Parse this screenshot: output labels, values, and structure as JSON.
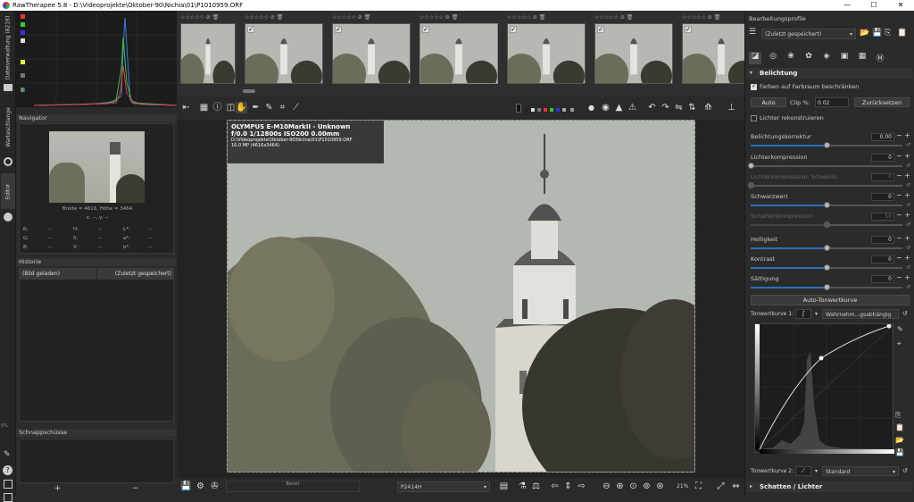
{
  "window": {
    "title": "RawTherapee 5.8 - D:\\Videoprojekte\\Oktober-90\\Nichia\\01\\P1010959.ORF",
    "minimize": "—",
    "maximize": "☐",
    "close": "✕"
  },
  "left_tabs": {
    "file_browser": "Dateiverwaltung (8216)",
    "queue": "Warteschlange",
    "editor": "Editor",
    "zoom_pct": "0%"
  },
  "navigator": {
    "title": "Navigator",
    "dims": "Breite = 4616, Höhe = 3464",
    "coords": "x: --, y: --",
    "rows": [
      [
        "R:",
        "--",
        "H:",
        "--",
        "L*:",
        "--"
      ],
      [
        "G:",
        "--",
        "S:",
        "--",
        "a*:",
        "--"
      ],
      [
        "B:",
        "--",
        "V:",
        "--",
        "b*:",
        "--"
      ]
    ]
  },
  "history": {
    "title": "Historie",
    "col1": "(Bild geladen)",
    "col2": "(Zuletzt gespeichert)"
  },
  "snapshots": {
    "title": "Schnappschüsse",
    "add": "+",
    "remove": "−"
  },
  "exif": {
    "camera": "OLYMPUS E-M10MarkII - Unknown",
    "settings": "f/0.0  1/12800s  ISO200  0.00mm",
    "path": "D:\\Videoprojekte\\Oktober-90\\Nichia\\01\\P1010959.ORF",
    "mp": "16.0 MP (4616x3464)"
  },
  "bottom": {
    "ready": "Bereit",
    "profile": "P2414H",
    "zoom": "21%"
  },
  "right": {
    "title": "Bearbeitungsprofile",
    "profile_value": "(Zuletzt gespeichert)",
    "section_exposure": "Belichtung",
    "clip_check": "Farben auf Farbraum beschränken",
    "auto": "Auto",
    "clip_label": "Clip %:",
    "clip_value": "0.02",
    "reset": "Zurücksetzen",
    "highlight_recon": "Lichter rekonstruieren",
    "sliders": [
      {
        "label": "Belichtungskorrektur",
        "value": "0.00",
        "pos": 0.5
      },
      {
        "label": "Lichterkompression",
        "value": "0",
        "pos": 0.0
      },
      {
        "label": "Lichterkompression: Schwelle",
        "value": "0",
        "pos": 0.0,
        "disabled": true
      },
      {
        "label": "Schwarzwert",
        "value": "0",
        "pos": 0.5
      },
      {
        "label": "Schattenkompression",
        "value": "50",
        "pos": 0.5,
        "disabled": true
      },
      {
        "label": "Helligkeit",
        "value": "0",
        "pos": 0.5
      },
      {
        "label": "Kontrast",
        "value": "0",
        "pos": 0.5
      },
      {
        "label": "Sättigung",
        "value": "0",
        "pos": 0.5
      }
    ],
    "auto_tone": "Auto-Tonwertkurve",
    "curve1_label": "Tonwertkurve 1:",
    "curve1_mode": "Wahrnehm...gsabhängig",
    "curve2_label": "Tonwertkurve 2:",
    "curve2_mode": "Standard",
    "section_shadows": "Schatten / Lichter"
  },
  "colors": {
    "accent": "#2d6fbf",
    "panel": "#2b2b2b"
  }
}
